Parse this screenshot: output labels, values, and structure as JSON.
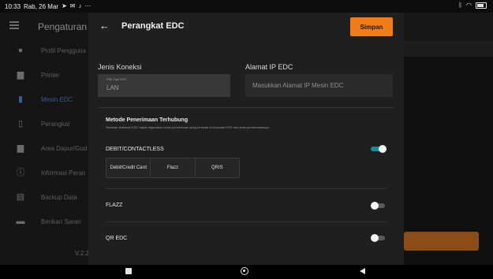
{
  "status_bar": {
    "time": "10:33",
    "date": "Rab, 26 Mar",
    "left_icons": [
      "navigation-icon",
      "mail-icon",
      "tiktok-icon",
      "more-icon"
    ],
    "right_icons": [
      "bluetooth-icon",
      "wifi-icon",
      "battery-icon"
    ]
  },
  "background_app": {
    "title": "Pengaturan",
    "sidebar": {
      "items": [
        {
          "label": "Profil Pengguna",
          "icon": "user-icon"
        },
        {
          "label": "Printer",
          "icon": "printer-icon"
        },
        {
          "label": "Mesin EDC",
          "icon": "edc-icon",
          "active": true
        },
        {
          "label": "Perangkat",
          "icon": "device-icon"
        },
        {
          "label": "Area Dapur/Gud",
          "icon": "kitchen-printer-icon"
        },
        {
          "label": "Informasi Peran",
          "icon": "info-icon"
        },
        {
          "label": "Backup Data",
          "icon": "backup-icon"
        },
        {
          "label": "Berikan Saran",
          "icon": "feedback-icon"
        }
      ],
      "version": "V.2.2"
    }
  },
  "dialog": {
    "title": "Perangkat EDC",
    "save_label": "Simpan",
    "connection": {
      "label": "Jenis Koneksi",
      "field_label": "Pilih Tipe EDC",
      "value": "LAN"
    },
    "ip": {
      "label": "Alamat IP EDC",
      "placeholder": "Masukkan Alamat IP Mesin EDC"
    },
    "method": {
      "title": "Metode Penerimaan Terhubung",
      "description": "Silahkan tentukan EDC dapat digunakan untuk penerimaan yang tersedia di Accurate POS dan jenis penerimaannya."
    },
    "options": [
      {
        "label": "DEBIT/CONTACTLESS",
        "enabled": true,
        "segments": [
          "Debit/Credit Card",
          "Flazz",
          "QRIS"
        ]
      },
      {
        "label": "FLAZZ",
        "enabled": false
      },
      {
        "label": "QR EDC",
        "enabled": false
      }
    ]
  },
  "colors": {
    "accent": "#f07d1a",
    "toggle_on": "#1f8a9a",
    "dialog_bg": "#1f1f1f"
  }
}
